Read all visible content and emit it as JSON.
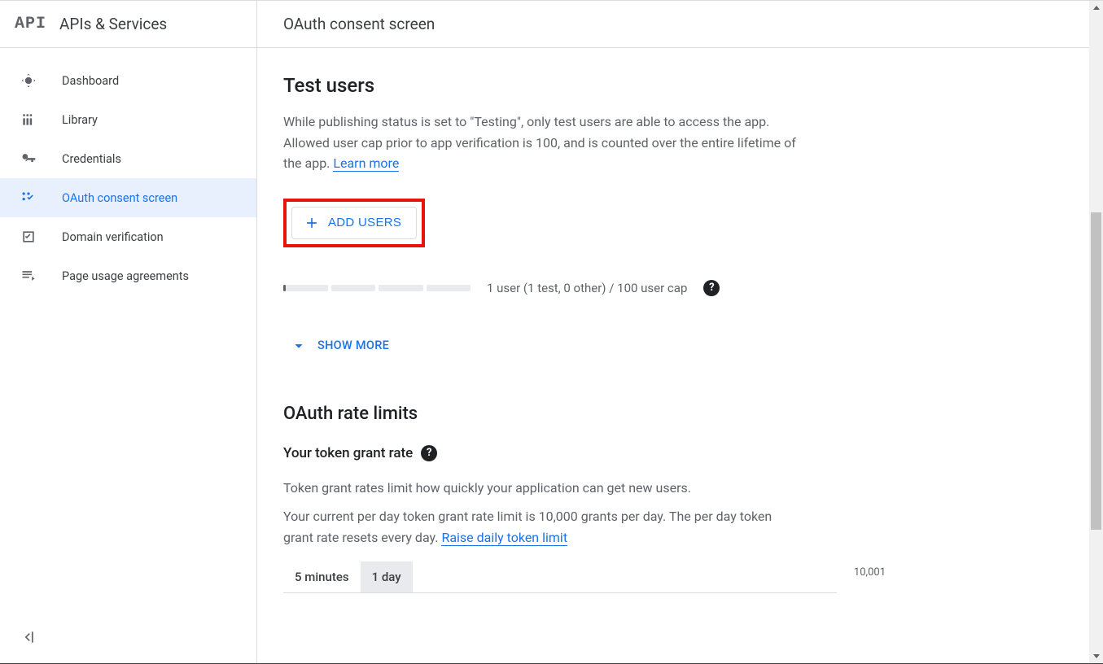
{
  "sidebar": {
    "logo_text": "API",
    "title": "APIs & Services",
    "items": [
      {
        "label": "Dashboard",
        "icon": "dashboard"
      },
      {
        "label": "Library",
        "icon": "library"
      },
      {
        "label": "Credentials",
        "icon": "key"
      },
      {
        "label": "OAuth consent screen",
        "icon": "consent",
        "active": true
      },
      {
        "label": "Domain verification",
        "icon": "check"
      },
      {
        "label": "Page usage agreements",
        "icon": "agreement"
      }
    ]
  },
  "header": {
    "title": "OAuth consent screen"
  },
  "test_users": {
    "heading": "Test users",
    "description": "While publishing status is set to \"Testing\", only test users are able to access the app. Allowed user cap prior to app verification is 100, and is counted over the entire lifetime of the app. ",
    "learn_more": "Learn more",
    "add_button": "ADD USERS",
    "progress_text": "1 user (1 test, 0 other) / 100 user cap",
    "show_more": "SHOW MORE"
  },
  "rate_limits": {
    "heading": "OAuth rate limits",
    "subheading": "Your token grant rate",
    "desc1": "Token grant rates limit how quickly your application can get new users.",
    "desc2a": "Your current per day token grant rate limit is 10,000 grants per day. The per day token grant rate resets every day. ",
    "raise_link": "Raise daily token limit",
    "tabs": [
      {
        "label": "5 minutes",
        "active": false
      },
      {
        "label": "1 day",
        "active": true
      }
    ],
    "axis_max": "10,001"
  }
}
